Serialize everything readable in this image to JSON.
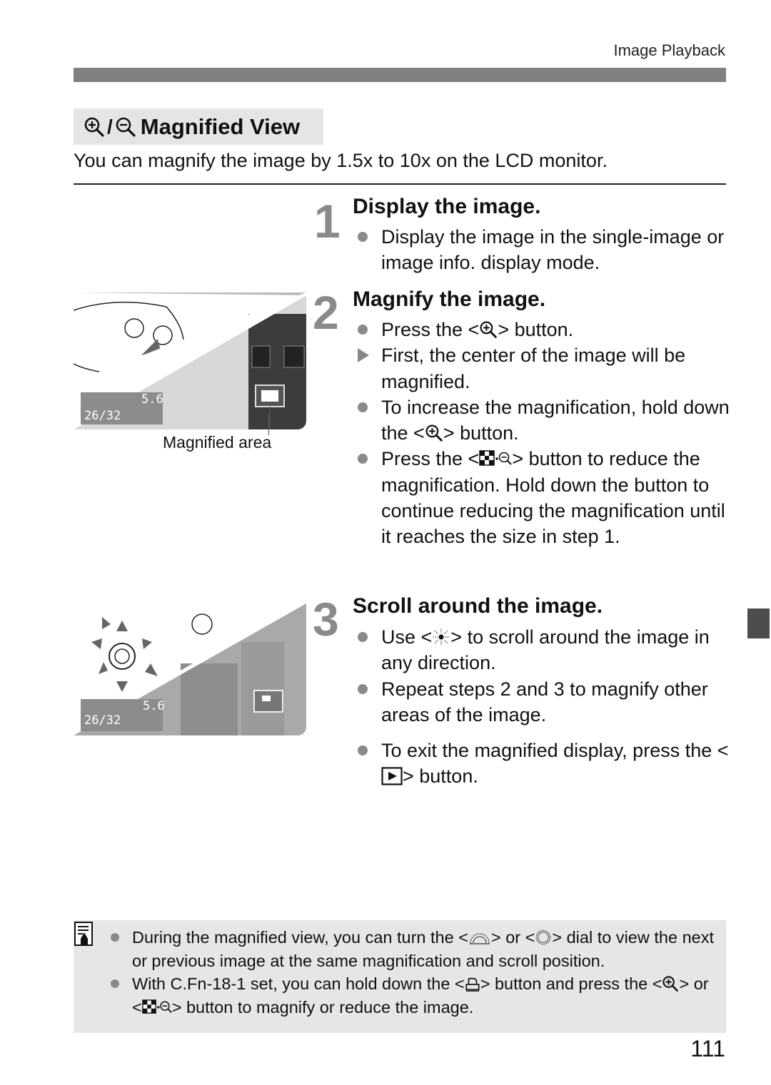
{
  "header": {
    "running_head": "Image Playback"
  },
  "section": {
    "title": "Magnified View",
    "title_icons": [
      "magnify-plus-icon",
      "magnify-minus-icon"
    ],
    "separator": "/",
    "intro": "You can magnify the image by 1.5x to 10x on the LCD monitor."
  },
  "steps": [
    {
      "number": "1",
      "title": "Display the image.",
      "items": [
        {
          "type": "bullet",
          "text": "Display the image in the single-image or image info. display mode."
        }
      ]
    },
    {
      "number": "2",
      "title": "Magnify the image.",
      "items": [
        {
          "type": "bullet",
          "pre": "Press the <",
          "icon": "magnify-plus-icon",
          "post": "> button."
        },
        {
          "type": "result",
          "text": "First, the center of the image will be magnified."
        },
        {
          "type": "bullet",
          "pre": "To increase the magnification, hold down the <",
          "icon": "magnify-plus-icon",
          "post": "> button."
        },
        {
          "type": "bullet",
          "pre": "Press the <",
          "icon": "index-reduce-icon",
          "post": "> button to reduce the magnification. Hold down the button to continue reducing the magnification until it reaches the size in step 1."
        }
      ]
    },
    {
      "number": "3",
      "title": "Scroll around the image.",
      "items": [
        {
          "type": "bullet",
          "pre": "Use <",
          "icon": "multi-controller-icon",
          "post": "> to scroll around the image in any direction."
        },
        {
          "type": "bullet",
          "text": "Repeat steps 2 and 3 to magnify other areas of the image."
        },
        {
          "type": "bullet",
          "pre": "To exit the magnified display, press the <",
          "icon": "playback-icon",
          "post": "> button."
        }
      ]
    }
  ],
  "figures": {
    "figure1": {
      "lcd_aperture": "5.6",
      "lcd_counter": "26/32",
      "caption": "Magnified area"
    },
    "figure2": {
      "lcd_aperture": "5.6",
      "lcd_counter": "26/32"
    }
  },
  "note": {
    "icon": "memo-icon",
    "items": [
      {
        "p1": "During the magnified view, you can turn the <",
        "icon1": "main-dial-icon",
        "p2": "> or <",
        "icon2": "quick-control-dial-icon",
        "p3": "> dial to view the next or previous image at the same magnification and scroll position."
      },
      {
        "p1": "With C.Fn-18-1 set, you can hold down the <",
        "icon1": "print-share-icon",
        "p2": "> button and press the <",
        "icon2": "magnify-plus-icon",
        "p3": "> or <",
        "icon3": "index-reduce-icon",
        "p4": "> button to magnify or reduce the image."
      }
    ]
  },
  "footer": {
    "page_number": "111"
  },
  "colors": {
    "accent_gray": "#808080",
    "step_number": "#8a8a8a",
    "note_bg": "#e6e6e6",
    "title_bg": "#e5e5e5",
    "thumb_tab": "#4d4d4d"
  }
}
